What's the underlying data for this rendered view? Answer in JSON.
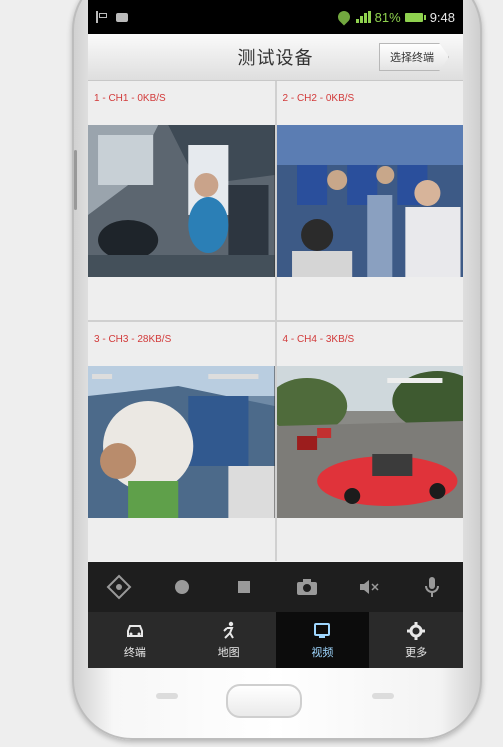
{
  "status_bar": {
    "battery": "81%",
    "time": "9:48"
  },
  "app": {
    "title": "测试设备",
    "select_button": "选择终端"
  },
  "channels": [
    {
      "label": "1 - CH1 - 0KB/S"
    },
    {
      "label": "2 - CH2 - 0KB/S"
    },
    {
      "label": "3 - CH3 - 28KB/S"
    },
    {
      "label": "4 - CH4 - 3KB/S"
    }
  ],
  "controls": {
    "icons": [
      "direction-pad-icon",
      "record-dot-icon",
      "stop-square-icon",
      "camera-icon",
      "mute-icon",
      "microphone-icon"
    ]
  },
  "nav": {
    "items": [
      {
        "label": "终端",
        "icon": "car-icon"
      },
      {
        "label": "地图",
        "icon": "runner-icon"
      },
      {
        "label": "视频",
        "icon": "monitor-icon"
      },
      {
        "label": "更多",
        "icon": "gear-icon"
      }
    ],
    "active_index": 2
  },
  "colors": {
    "channel_label": "#d23a3a",
    "nav_active": "#9fd7ff",
    "accent": "#8fd14f"
  }
}
